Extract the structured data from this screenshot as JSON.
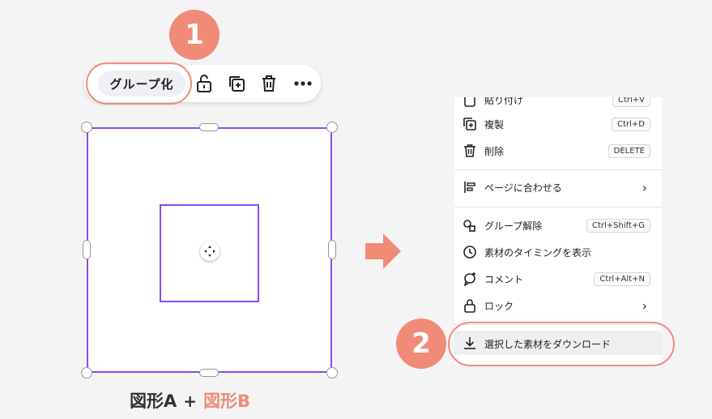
{
  "badges": {
    "one": "1",
    "two": "2"
  },
  "toolbar": {
    "group_label": "グループ化",
    "icons": [
      "lock-icon",
      "duplicate-icon",
      "trash-icon",
      "more-icon"
    ]
  },
  "caption": {
    "shape_a": "図形A",
    "plus": "+",
    "shape_b": "図形B"
  },
  "menu": {
    "items": [
      {
        "label": "貼り付け",
        "shortcut": "Ctrl+V",
        "icon": "paste-icon"
      },
      {
        "label": "複製",
        "shortcut": "Ctrl+D",
        "icon": "duplicate-icon"
      },
      {
        "label": "削除",
        "shortcut": "DELETE",
        "icon": "trash-icon"
      },
      {
        "label": "ページに合わせる",
        "shortcut": "",
        "icon": "align-icon"
      },
      {
        "label": "グループ解除",
        "shortcut": "Ctrl+Shift+G",
        "icon": "ungroup-icon"
      },
      {
        "label": "素材のタイミングを表示",
        "shortcut": "",
        "icon": "clock-icon"
      },
      {
        "label": "コメント",
        "shortcut": "Ctrl+Alt+N",
        "icon": "comment-icon"
      },
      {
        "label": "ロック",
        "shortcut": "",
        "icon": "lock-icon"
      },
      {
        "label": "選択した素材をダウンロード",
        "shortcut": "",
        "icon": "download-icon"
      }
    ]
  },
  "colors": {
    "accent": "#f08b78",
    "selection": "#8a4cf0"
  }
}
